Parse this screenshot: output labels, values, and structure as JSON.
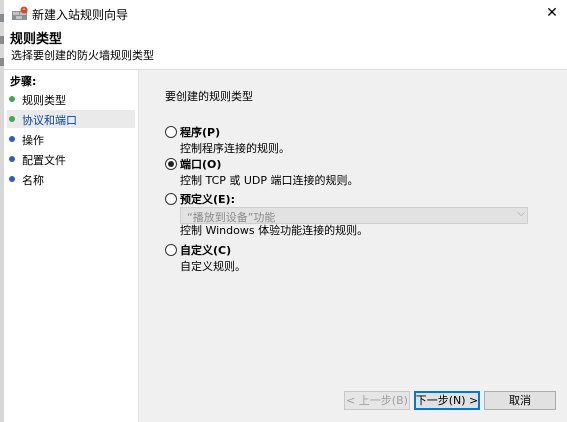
{
  "window": {
    "title": "新建入站规则向导",
    "close_glyph": "✕"
  },
  "header": {
    "title": "规则类型",
    "subtitle": "选择要创建的防火墙规则类型"
  },
  "steps": {
    "title": "步骤:",
    "items": [
      {
        "label": "规则类型",
        "state": "done"
      },
      {
        "label": "协议和端口",
        "state": "current"
      },
      {
        "label": "操作",
        "state": "todo"
      },
      {
        "label": "配置文件",
        "state": "todo"
      },
      {
        "label": "名称",
        "state": "todo"
      }
    ]
  },
  "main": {
    "prompt": "要创建的规则类型",
    "options": [
      {
        "label": "程序(P)",
        "desc": "控制程序连接的规则。",
        "selected": false
      },
      {
        "label": "端口(O)",
        "desc": "控制 TCP 或 UDP 端口连接的规则。",
        "selected": true
      },
      {
        "label": "预定义(E):",
        "desc": "控制 Windows 体验功能连接的规则。",
        "selected": false
      },
      {
        "label": "自定义(C)",
        "desc": "自定义规则。",
        "selected": false
      }
    ],
    "predefined_select": {
      "value": "“播放到设备”功能",
      "enabled": false
    }
  },
  "buttons": {
    "back": "< 上一步(B)",
    "next": "下一步(N) >",
    "cancel": "取消"
  },
  "icons": {
    "app": "firewall-wizard-icon",
    "close": "close-icon",
    "dropdown": "chevron-down-icon"
  }
}
